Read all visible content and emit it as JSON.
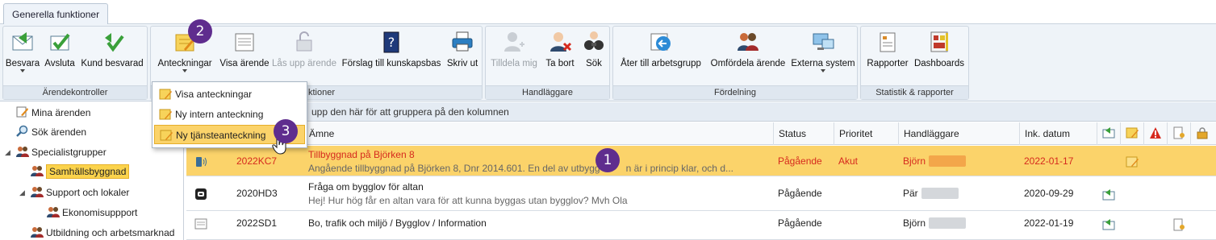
{
  "tabs": [
    {
      "label": "Generella funktioner"
    }
  ],
  "ribbon": {
    "groups": [
      {
        "label": "Ärendekontroller",
        "buttons": [
          "Besvara",
          "Avsluta",
          "Kund besvarad"
        ]
      },
      {
        "label": "ktioner",
        "buttons": [
          "Anteckningar",
          "Visa ärende",
          "Lås upp ärende",
          "Förslag till kunskapsbas",
          "Skriv ut"
        ]
      },
      {
        "label": "Handläggare",
        "buttons": [
          "Tilldela mig",
          "Ta bort",
          "Sök"
        ]
      },
      {
        "label": "Fördelning",
        "buttons": [
          "Åter till arbetsgrupp",
          "Omfördela ärende",
          "Externa system"
        ]
      },
      {
        "label": "Statistik & rapporter",
        "buttons": [
          "Rapporter",
          "Dashboards"
        ]
      }
    ]
  },
  "dropdown": {
    "items": [
      "Visa anteckningar",
      "Ny intern anteckning",
      "Ny tjänsteanteckning"
    ]
  },
  "tree": {
    "items": [
      "Mina ärenden",
      "Sök ärenden",
      "Specialistgrupper",
      "Samhällsbyggnad",
      "Support och lokaler",
      "Ekonomisuppport",
      "Utbildning och arbetsmarknad"
    ]
  },
  "grid": {
    "group_hint": "upp den här för att gruppera på den kolumnen",
    "columns": [
      "Ämne",
      "Status",
      "Prioritet",
      "Handläggare",
      "Ink. datum"
    ],
    "rows": [
      {
        "id": "2022KC7",
        "subject": "Tillbyggnad på Björken 8",
        "preview": "Angående tillbyggnad på Björken 8, Dnr 2014.601. En del av utbygg",
        "preview_tail": "n är i princip klar, och d...",
        "status": "Pågående",
        "priority": "Akut",
        "handler": "Björn",
        "date": "2022-01-17"
      },
      {
        "id": "2020HD3",
        "subject": "Fråga om bygglov för altan",
        "preview": "Hej! Hur hög får en altan vara för att kunna byggas utan bygglov? Mvh Ola",
        "status": "Pågående",
        "priority": "",
        "handler": "Pär",
        "date": "2020-09-29"
      },
      {
        "id": "2022SD1",
        "subject": "Bo, trafik och miljö / Bygglov / Information",
        "status": "Pågående",
        "priority": "",
        "handler": "Björn",
        "date": "2022-01-19"
      }
    ]
  },
  "markers": [
    "1",
    "2",
    "3"
  ],
  "colors": {
    "highlight": "#fbd36a",
    "marker": "#5f2d8e",
    "urgent": "#d62a1e",
    "selected": "#fbd34c"
  }
}
